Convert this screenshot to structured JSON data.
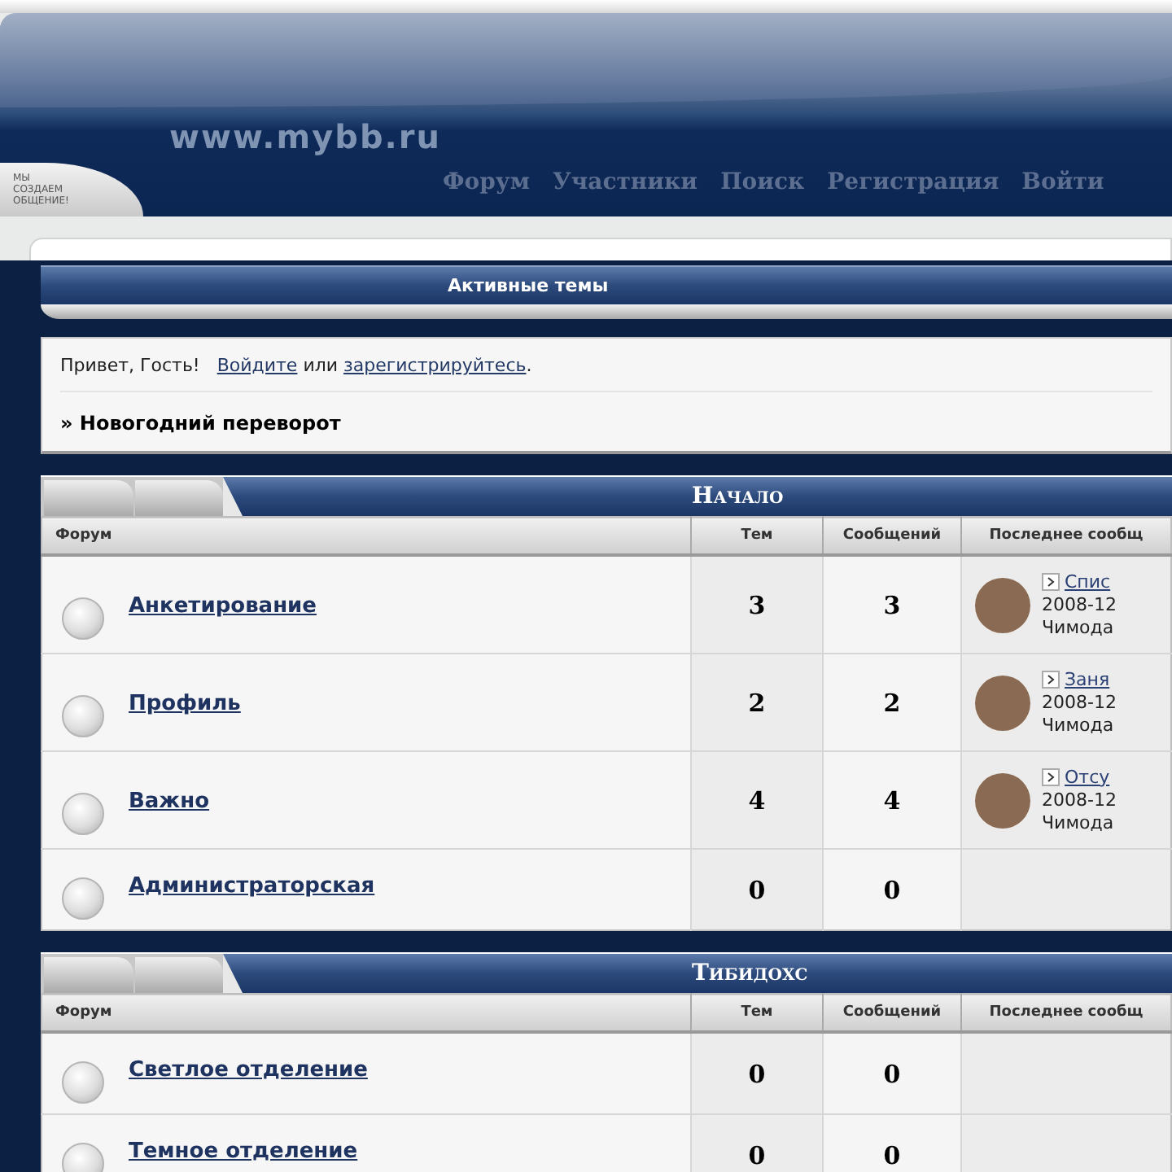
{
  "header": {
    "logo": "www.mybb.ru",
    "slogan": [
      "МЫ",
      "СОЗДАЕМ",
      "ОБЩЕНИЕ!"
    ],
    "nav": [
      "Форум",
      "Участники",
      "Поиск",
      "Регистрация",
      "Войти"
    ]
  },
  "active_topics": {
    "title": "Активные темы"
  },
  "greeting": {
    "text": "Привет, Гость!",
    "login_link": "Войдите",
    "conjunction": "или",
    "register_link": "зарегистрируйтесь",
    "end": "."
  },
  "announcement": "» Новогодний переворот",
  "categories": [
    {
      "title": "Начало",
      "columns": [
        "Форум",
        "Тем",
        "Сообщений",
        "Последнее сообщ"
      ],
      "forums": [
        {
          "name": "Анкетирование",
          "topics": "3",
          "posts": "3",
          "last_post": {
            "topic": "Спис",
            "date": "2008-12",
            "author": "Чимода"
          }
        },
        {
          "name": "Профиль",
          "topics": "2",
          "posts": "2",
          "last_post": {
            "topic": "Заня",
            "date": "2008-12",
            "author": "Чимода"
          }
        },
        {
          "name": "Важно",
          "topics": "4",
          "posts": "4",
          "last_post": {
            "topic": "Отсу",
            "date": "2008-12",
            "author": "Чимода"
          }
        },
        {
          "name": "Администраторская",
          "topics": "0",
          "posts": "0"
        }
      ]
    },
    {
      "title": "Тибидохс",
      "columns": [
        "Форум",
        "Тем",
        "Сообщений",
        "Последнее сообщ"
      ],
      "forums": [
        {
          "name": "Светлое отделение",
          "topics": "0",
          "posts": "0"
        },
        {
          "name": "Темное отделение",
          "topics": "0",
          "posts": "0"
        }
      ]
    }
  ]
}
